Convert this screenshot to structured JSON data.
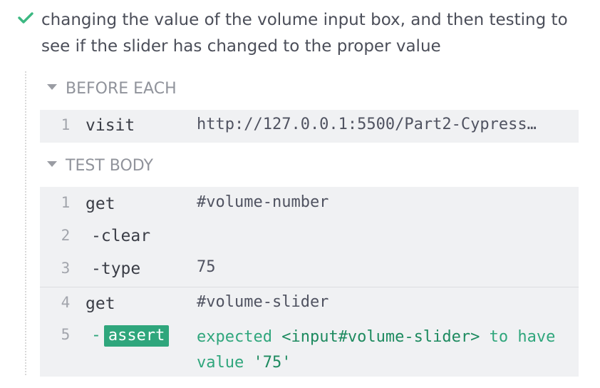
{
  "test": {
    "status": "passed",
    "title": "changing the value of the volume input box, and then testing to see if the slider has changed to the proper value"
  },
  "before_each": {
    "header": "BEFORE EACH",
    "commands": [
      {
        "num": "1",
        "name": "visit",
        "arg": "http://127.0.0.1:5500/Part2-Cypress…"
      }
    ]
  },
  "test_body": {
    "header": "TEST BODY",
    "commands": [
      {
        "num": "1",
        "name": "get",
        "arg": "#volume-number"
      },
      {
        "num": "2",
        "name": "-clear",
        "arg": ""
      },
      {
        "num": "3",
        "name": "-type",
        "arg": "75"
      },
      {
        "num": "4",
        "name": "get",
        "arg": "#volume-slider"
      },
      {
        "num": "5",
        "name": "assert",
        "dash": "-",
        "arg_parts": [
          "expected",
          "<input#volume-slider>",
          "to have value",
          "'75'"
        ]
      }
    ]
  },
  "colors": {
    "pass_green": "#2fa67c",
    "check_green": "#3cb882",
    "block_bg": "#f0f1f3"
  }
}
